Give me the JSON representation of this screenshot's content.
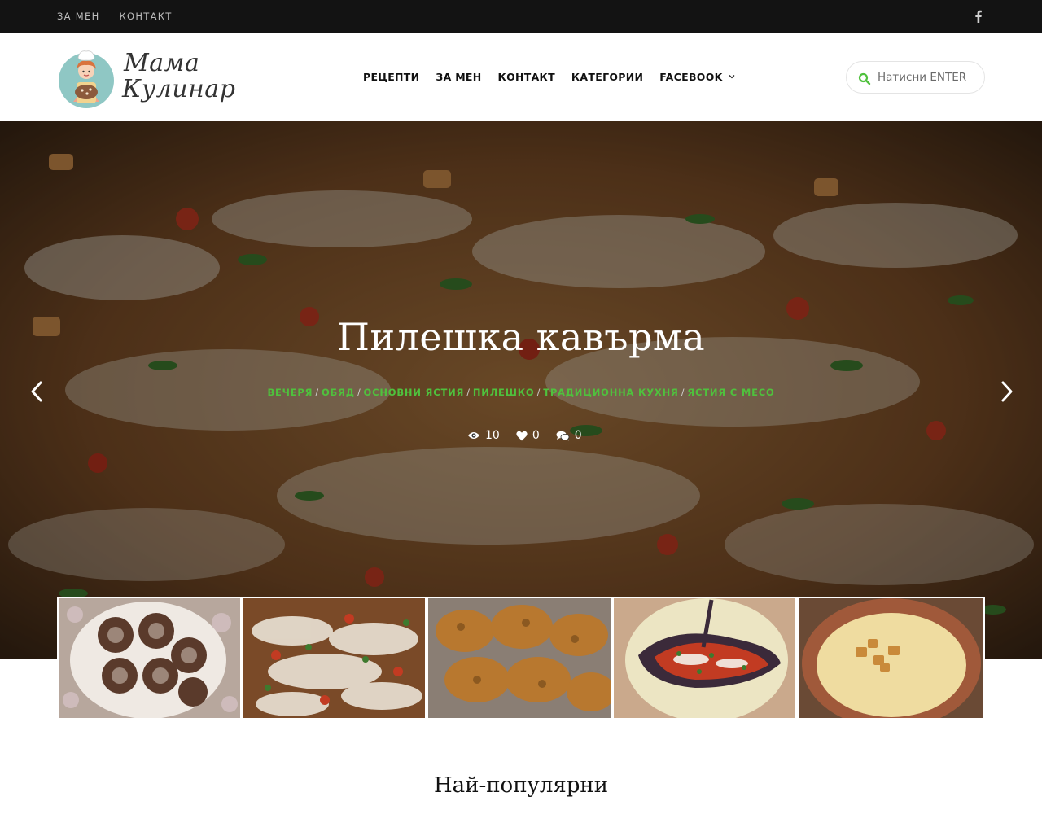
{
  "topbar": {
    "links": [
      "ЗА МЕН",
      "КОНТАКТ"
    ],
    "social_icon": "facebook-icon"
  },
  "logo": {
    "line1": "Мама",
    "line2": "Кулинар"
  },
  "nav": {
    "items": [
      "РЕЦЕПТИ",
      "ЗА МЕН",
      "КОНТАКТ",
      "КАТЕГОРИИ",
      "FACEBOOK"
    ]
  },
  "search": {
    "placeholder": "Натисни ENTER"
  },
  "hero": {
    "title": "Пилешка кавърма",
    "categories": [
      "ВЕЧЕРЯ",
      "ОБЯД",
      "ОСНОВНИ ЯСТИЯ",
      "ПИЛЕШКО",
      "ТРАДИЦИОННА КУХНЯ",
      "ЯСТИЯ С МЕСО"
    ],
    "separator": "/",
    "stats": {
      "views": "10",
      "likes": "0",
      "comments": "0"
    }
  },
  "section": {
    "title": "Най-популярни"
  },
  "colors": {
    "accent": "#4fc13d",
    "topbar": "#131313",
    "text": "#111111"
  }
}
